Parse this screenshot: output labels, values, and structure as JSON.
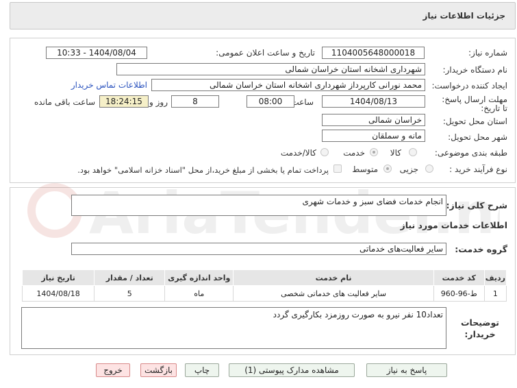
{
  "header": {
    "title": "جزئیات اطلاعات نیاز"
  },
  "form": {
    "need_number_label": "شماره نیاز:",
    "need_number": "1104005648000018",
    "announce_label": "تاریخ و ساعت اعلان عمومی:",
    "announce_value": "1404/08/04 - 10:33",
    "buyer_org_label": "نام دستگاه خریدار:",
    "buyer_org": "شهرداری اشخانه استان خراسان شمالی",
    "creator_label": "ایجاد کننده درخواست:",
    "creator": "محمد نورانی کارپرداز شهرداری اشخانه استان خراسان شمالی",
    "contact_link": "اطلاعات تماس خریدار",
    "deadline_label": "مهلت ارسال پاسخ: تا تاریخ:",
    "deadline_date": "1404/08/13",
    "time_label": "ساعت",
    "deadline_time": "08:00",
    "days_value": "8",
    "days_label": "روز و",
    "remaining_time": "18:24:15",
    "remaining_label": "ساعت باقی مانده",
    "province_label": "استان محل تحویل:",
    "province": "خراسان شمالی",
    "city_label": "شهر محل تحویل:",
    "city": "مانه و سملقان",
    "category_label": "طبقه بندی موضوعی:",
    "category_options": [
      "کالا",
      "خدمت",
      "کالا/خدمت"
    ],
    "category_selected": "خدمت",
    "process_label": "نوع فرآیند خرید :",
    "process_options": [
      "جزیی",
      "متوسط"
    ],
    "process_selected": "متوسط",
    "payment_note": "پرداخت تمام یا بخشی از مبلغ خرید،از محل \"اسناد خزانه اسلامی\" خواهد بود."
  },
  "summary": {
    "label": "شرح کلی نیاز:",
    "value": "انجام خدمات فضای سبز و خدمات شهری"
  },
  "services": {
    "section_title": "اطلاعات خدمات مورد نیاز",
    "group_label": "گروه خدمت:",
    "group_value": "سایر فعالیت‌های خدماتی",
    "columns": [
      "ردیف",
      "کد خدمت",
      "نام خدمت",
      "واحد اندازه گیری",
      "تعداد / مقدار",
      "تاریخ نیاز"
    ],
    "rows": [
      {
        "index": "1",
        "code": "ط-96-960",
        "name": "سایر فعالیت های خدماتی شخصی",
        "unit": "ماه",
        "qty": "5",
        "date": "1404/08/18"
      }
    ]
  },
  "buyer_notes": {
    "label": "توضیحات خریدار:",
    "value": "تعداد10 نفر نیرو به صورت روزمزد بکارگیری گردد"
  },
  "buttons": {
    "reply": "پاسخ به نیاز",
    "attachments": "مشاهده مدارک پیوستی (1)",
    "print": "چاپ",
    "back": "بازگشت",
    "exit": "خروج"
  },
  "watermark": {
    "text": "AriaTender.net"
  }
}
